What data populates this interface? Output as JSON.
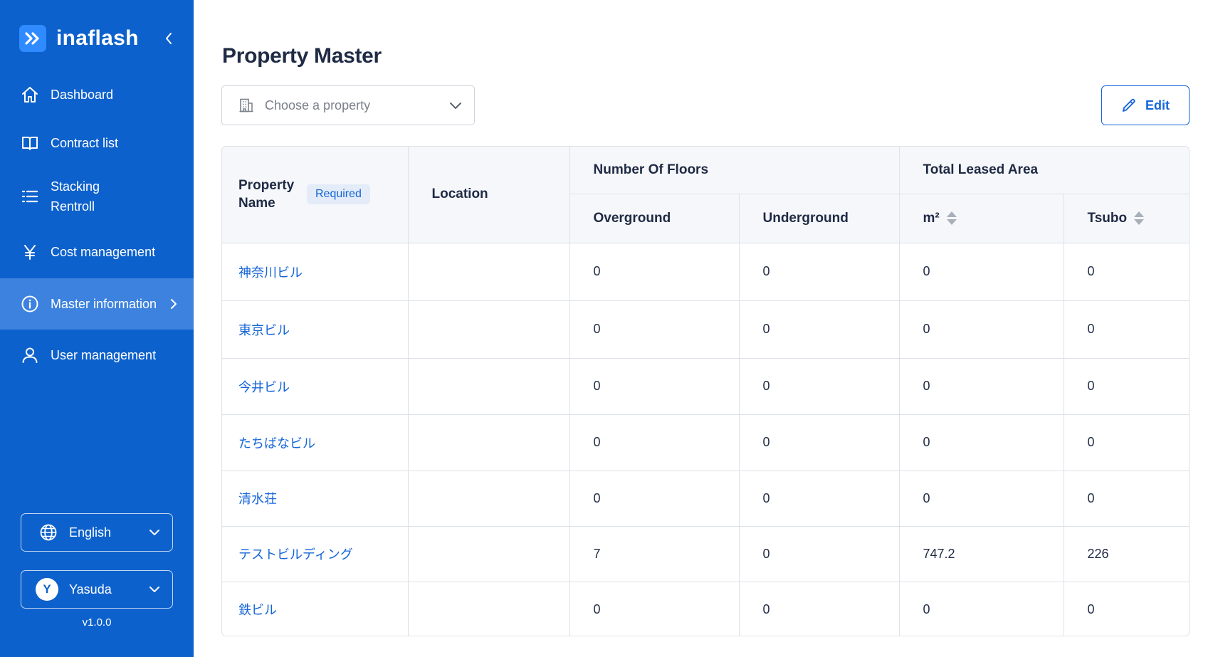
{
  "app": {
    "name": "inaflash"
  },
  "sidebar": {
    "items": [
      {
        "label": "Dashboard",
        "icon": "home-icon"
      },
      {
        "label": "Contract list",
        "icon": "book-icon"
      },
      {
        "label": "Stacking\nRentroll",
        "icon": "list-icon"
      },
      {
        "label": "Cost management",
        "icon": "yen-icon"
      },
      {
        "label": "Master information",
        "icon": "info-icon",
        "active": true
      },
      {
        "label": "User management",
        "icon": "user-icon"
      }
    ],
    "language": {
      "label": "English"
    },
    "user": {
      "initial": "Y",
      "name": "Yasuda"
    },
    "version": "v1.0.0"
  },
  "main": {
    "title": "Property Master",
    "property_select": {
      "placeholder": "Choose a property"
    },
    "edit_label": "Edit",
    "table": {
      "headers": {
        "property_name": "Property Name",
        "required": "Required",
        "location": "Location",
        "floors_group": "Number Of Floors",
        "overground": "Overground",
        "underground": "Underground",
        "area_group": "Total Leased Area",
        "m2": "m²",
        "tsubo": "Tsubo"
      },
      "rows": [
        {
          "name": "神奈川ビル",
          "location": "",
          "overground": "0",
          "underground": "0",
          "m2": "0",
          "tsubo": "0"
        },
        {
          "name": "東京ビル",
          "location": "",
          "overground": "0",
          "underground": "0",
          "m2": "0",
          "tsubo": "0"
        },
        {
          "name": "今井ビル",
          "location": "",
          "overground": "0",
          "underground": "0",
          "m2": "0",
          "tsubo": "0"
        },
        {
          "name": "たちばなビル",
          "location": "",
          "overground": "0",
          "underground": "0",
          "m2": "0",
          "tsubo": "0"
        },
        {
          "name": "清水荘",
          "location": "",
          "overground": "0",
          "underground": "0",
          "m2": "0",
          "tsubo": "0"
        },
        {
          "name": "テストビルディング",
          "location": "",
          "overground": "7",
          "underground": "0",
          "m2": "747.2",
          "tsubo": "226"
        },
        {
          "name": "鉄ビル",
          "location": "",
          "overground": "0",
          "underground": "0",
          "m2": "0",
          "tsubo": "0"
        }
      ]
    }
  },
  "colors": {
    "sidebar": "#0d61cc",
    "accent": "#1565d8",
    "active_item": "#3d82de"
  }
}
